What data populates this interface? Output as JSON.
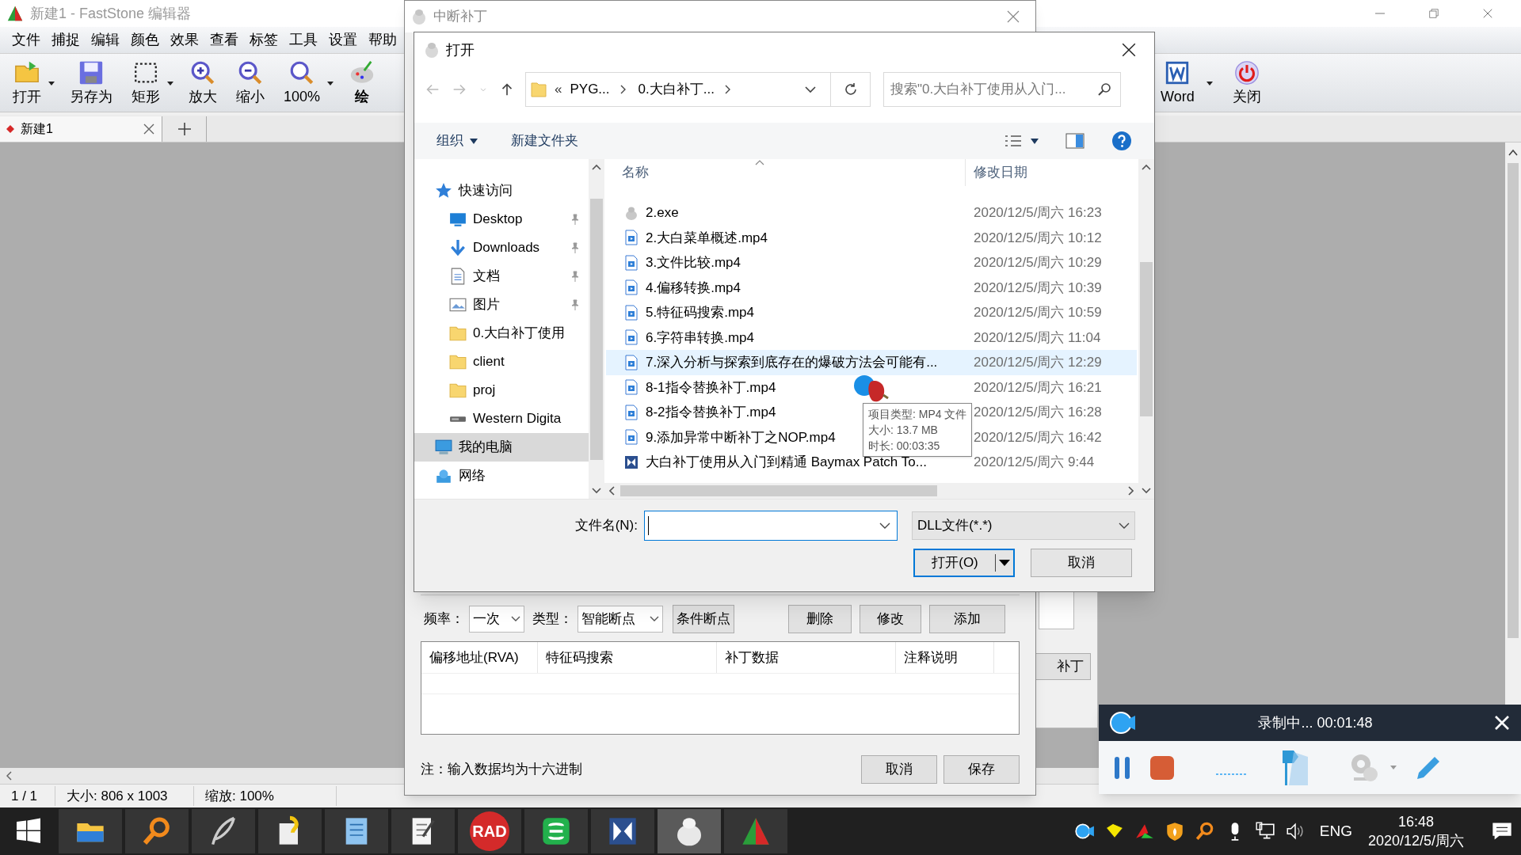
{
  "main_window": {
    "title": "新建1 - FastStone 编辑器",
    "menu": [
      "文件",
      "捕捉",
      "编辑",
      "颜色",
      "效果",
      "查看",
      "标签",
      "工具",
      "设置",
      "帮助"
    ],
    "toolbar_left": [
      {
        "kind": "open",
        "label": "打开",
        "dropdown": true
      },
      {
        "kind": "save",
        "label": "另存为",
        "dropdown": false
      },
      {
        "kind": "rect",
        "label": "矩形",
        "dropdown": true
      },
      {
        "kind": "zoomin",
        "label": "放大",
        "dropdown": false
      },
      {
        "kind": "zoomout",
        "label": "缩小",
        "dropdown": false
      },
      {
        "kind": "zoomfit",
        "label": "100%",
        "dropdown": true
      },
      {
        "kind": "draw",
        "label": "绘",
        "dropdown": false
      }
    ],
    "toolbar_right": [
      {
        "kind": "word",
        "label": "Word",
        "dropdown": true
      },
      {
        "kind": "power",
        "label": "关闭",
        "dropdown": false
      }
    ],
    "tabs": [
      {
        "label": "新建1",
        "selected": true
      }
    ],
    "status_bar": [
      "1 / 1",
      "大小: 806 x 1003",
      "缩放: 100%"
    ]
  },
  "patch_dialog": {
    "title": "中断补丁",
    "frequency_label": "频率：",
    "frequency": "一次",
    "type_label": "类型：",
    "type": "智能断点",
    "buttons": [
      "条件断点",
      "删除",
      "修改",
      "添加"
    ],
    "table": {
      "columns": [
        "偏移地址(RVA)",
        "特征码搜索",
        "补丁数据",
        "注释说明"
      ]
    },
    "note": "注：输入数据均为十六进制",
    "footer_buttons": [
      "取消",
      "保存"
    ]
  },
  "side_button": "补丁",
  "open_dialog": {
    "title": "打开",
    "path": [
      "PYG...",
      "0.大白补丁..."
    ],
    "path_prefix": "«",
    "search": {
      "placeholder": "搜索\"0.大白补丁使用从入门..."
    },
    "commands": [
      "组织",
      "新建文件夹"
    ],
    "nav": [
      {
        "kind": "quick",
        "label": "快速访问",
        "pinned": false,
        "selected": false
      },
      {
        "kind": "desktop",
        "label": "Desktop",
        "pinned": true,
        "selected": false
      },
      {
        "kind": "download",
        "label": "Downloads",
        "pinned": true,
        "selected": false
      },
      {
        "kind": "docs",
        "label": "文档",
        "pinned": true,
        "selected": false
      },
      {
        "kind": "pics",
        "label": "图片",
        "pinned": true,
        "selected": false
      },
      {
        "kind": "folder",
        "label": "0.大白补丁使用",
        "pinned": false,
        "selected": false
      },
      {
        "kind": "folder",
        "label": "client",
        "pinned": false,
        "selected": false
      },
      {
        "kind": "folder",
        "label": "proj",
        "pinned": false,
        "selected": false
      },
      {
        "kind": "drive",
        "label": "Western Digita",
        "pinned": false,
        "selected": false
      },
      {
        "kind": "pc",
        "label": "我的电脑",
        "pinned": false,
        "selected": true
      },
      {
        "kind": "network",
        "label": "网络",
        "pinned": false,
        "selected": false
      }
    ],
    "columns": [
      "名称",
      "修改日期"
    ],
    "files": [
      {
        "kind": "exe",
        "name": "2.exe",
        "date": "2020/12/5/周六 16:23",
        "selected": false
      },
      {
        "kind": "video",
        "name": "2.大白菜单概述.mp4",
        "date": "2020/12/5/周六 10:12",
        "selected": false
      },
      {
        "kind": "video",
        "name": "3.文件比较.mp4",
        "date": "2020/12/5/周六 10:29",
        "selected": false
      },
      {
        "kind": "video",
        "name": "4.偏移转换.mp4",
        "date": "2020/12/5/周六 10:39",
        "selected": false
      },
      {
        "kind": "video",
        "name": "5.特征码搜索.mp4",
        "date": "2020/12/5/周六 10:59",
        "selected": false
      },
      {
        "kind": "video",
        "name": "6.字符串转换.mp4",
        "date": "2020/12/5/周六 11:04",
        "selected": false
      },
      {
        "kind": "video",
        "name": "7.深入分析与探索到底存在的爆破方法会可能有...",
        "date": "2020/12/5/周六 12:29",
        "selected": true
      },
      {
        "kind": "video",
        "name": "8-1指令替换补丁.mp4",
        "date": "2020/12/5/周六 16:21",
        "selected": false
      },
      {
        "kind": "video",
        "name": "8-2指令替换补丁.mp4",
        "date": "2020/12/5/周六 16:28",
        "selected": false
      },
      {
        "kind": "video",
        "name": "9.添加异常中断补丁之NOP.mp4",
        "date": "2020/12/5/周六 16:42",
        "selected": false
      },
      {
        "kind": "app",
        "name": "大白补丁使用从入门到精通 Baymax Patch To...",
        "date": "2020/12/5/周六 9:44",
        "selected": false
      }
    ],
    "tooltip": [
      "项目类型: MP4 文件",
      "大小: 13.7 MB",
      "时长: 00:03:35"
    ],
    "filename_label": "文件名(N):",
    "file_type": "DLL文件(*.*)",
    "open_button": "打开(O)",
    "cancel_button": "取消"
  },
  "recorder": {
    "status": "录制中... 00:01:48"
  },
  "taskbar": {
    "apps": [
      {
        "kind": "explorer",
        "active": false
      },
      {
        "kind": "search",
        "active": false
      },
      {
        "kind": "feather",
        "active": false
      },
      {
        "kind": "help",
        "active": false
      },
      {
        "kind": "notebook",
        "active": false
      },
      {
        "kind": "notepad",
        "active": false
      },
      {
        "kind": "rad",
        "label": "RAD",
        "active": false
      },
      {
        "kind": "sheet",
        "active": false
      },
      {
        "kind": "xapp",
        "active": false
      },
      {
        "kind": "baymax",
        "active": true
      },
      {
        "kind": "faststone",
        "active": false
      }
    ],
    "language": "ENG",
    "time": "16:48",
    "date": "2020/12/5/周六"
  }
}
